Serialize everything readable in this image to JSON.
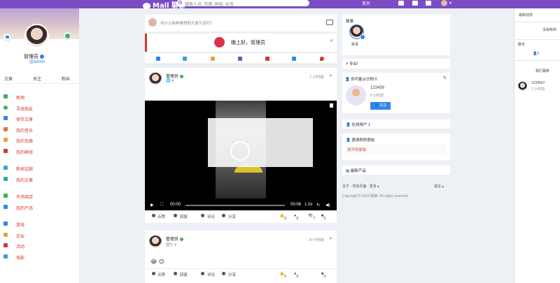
{
  "topbar": {
    "logo": "Mall 聊聊",
    "search_placeholder": "搜索人员, 页面, 群组, 标签",
    "home_label": "首页"
  },
  "user": {
    "name": "管理员",
    "handle": "@admin"
  },
  "left_tabs": [
    "文章",
    "关注",
    "粉丝"
  ],
  "left_menu": {
    "group1": [
      "新闻",
      "寻找朋友",
      "保存文章",
      "我的音乐",
      "我的页面",
      "我的群组"
    ],
    "group2": [
      "新闻话题",
      "我的文章"
    ],
    "group3": [
      "市场商店",
      "我的产品"
    ],
    "group4": [
      "游戏",
      "论坛",
      "活动",
      "电影"
    ]
  },
  "composer": {
    "placeholder": "有什么新鲜事想和大家分享吗？"
  },
  "greeting": {
    "text": "晚上好，管理员"
  },
  "posts": [
    {
      "name": "管理员",
      "sub": "🌐 ▾",
      "time": "7 小时前",
      "video": {
        "current": "00:00",
        "duration": "00:06",
        "speed": "1.0x"
      },
      "actions": {
        "like": "点赞",
        "reply": "回复",
        "comment": "评论",
        "share": "分享"
      },
      "stats": {
        "likes": "0",
        "reacts": "0",
        "views": "7",
        "comments": "0"
      }
    },
    {
      "name": "管理员",
      "sub": "图片 ▾",
      "time": "8 小时前",
      "content": "😂 😊",
      "actions": {
        "like": "点赞",
        "reply": "回复",
        "comment": "评论",
        "share": "分享"
      },
      "stats": {
        "likes": "0",
        "reacts": "0",
        "views": "",
        "comments": "0"
      }
    }
  ],
  "stories": {
    "title": "故事",
    "item": "故事"
  },
  "pro": {
    "title": "专业!"
  },
  "suggest": {
    "title": "你可能认识的人",
    "name": "123456",
    "time": "6 小时前",
    "follow": "关注"
  },
  "online": {
    "title": "在线用户 1"
  },
  "invite": {
    "title": "邀请你的朋友",
    "empty": "找不到朋友"
  },
  "latest": {
    "title": "最新产品"
  },
  "footer": {
    "links": "关于 · 所有页面 · 更多 ▴",
    "language": "语言 ▴",
    "copyright": "Copyright © 2018 聊聊. All rights reserved"
  },
  "right_panel": {
    "title": "最新动态",
    "empty1": "没有新的",
    "online_label": "聊天",
    "online_count": "0",
    "recent_label": "我们最新",
    "user_name": "1234567",
    "user_time": "7 小时前"
  },
  "colors": {
    "brand": "#7b4cc4",
    "accent": "#d3392e",
    "blue": "#2e87e8",
    "green": "#3db35a"
  }
}
